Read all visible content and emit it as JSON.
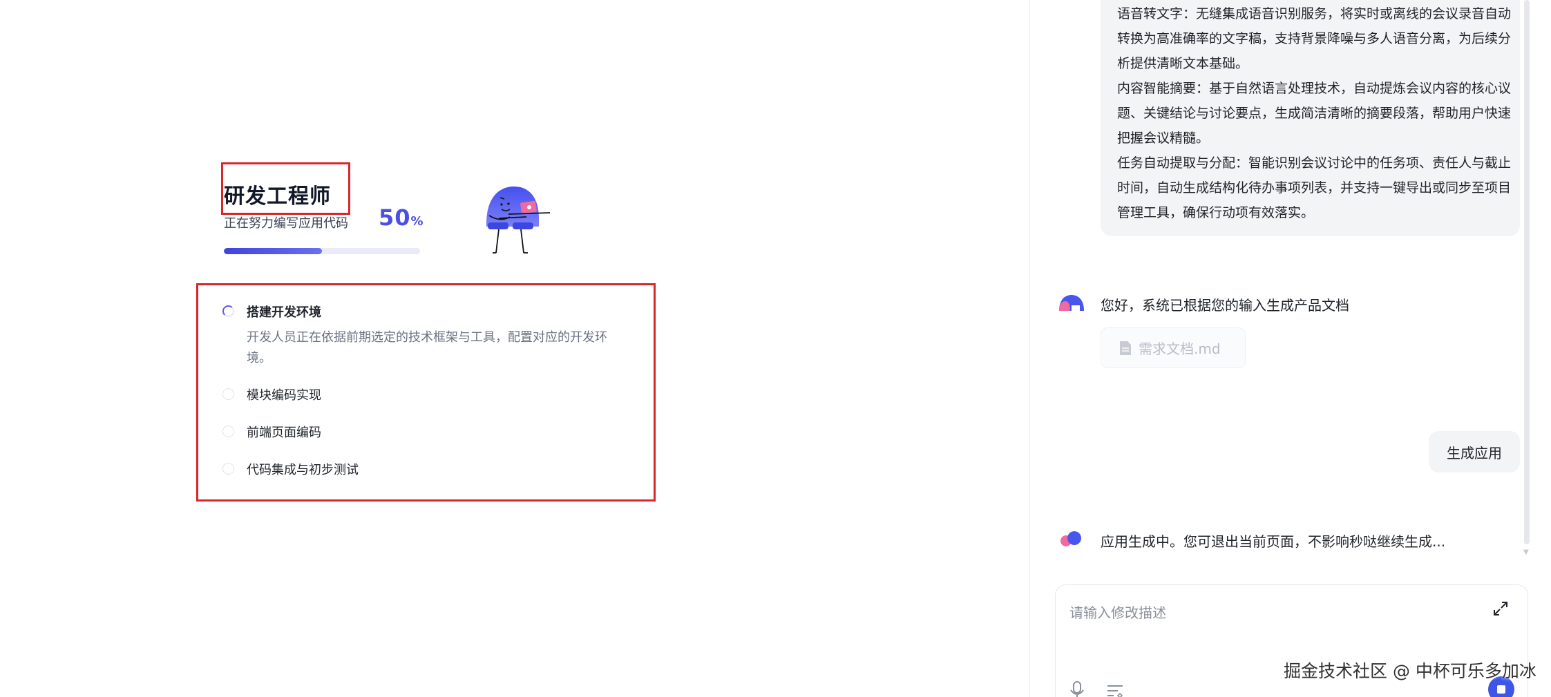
{
  "workflow": {
    "role_title": "研发工程师",
    "role_subtitle": "正在努力编写应用代码",
    "progress_value": "50",
    "progress_unit": "%",
    "progress_fraction": 0.5,
    "steps": [
      {
        "label": "搭建开发环境",
        "status": "in-progress",
        "description": "开发人员正在依据前期选定的技术框架与工具，配置对应的开发环境。"
      },
      {
        "label": "模块编码实现",
        "status": "pending"
      },
      {
        "label": "前端页面编码",
        "status": "pending"
      },
      {
        "label": "代码集成与初步测试",
        "status": "pending"
      }
    ]
  },
  "chat": {
    "requirement_paragraphs": [
      "语音转文字：无缝集成语音识别服务，将实时或离线的会议录音自动转换为高准确率的文字稿，支持背景降噪与多人语音分离，为后续分析提供清晰文本基础。",
      "内容智能摘要：基于自然语言处理技术，自动提炼会议内容的核心议题、关键结论与讨论要点，生成简洁清晰的摘要段落，帮助用户快速把握会议精髓。",
      "任务自动提取与分配：智能识别会议讨论中的任务项、责任人与截止时间，自动生成结构化待办事项列表，并支持一键导出或同步至项目管理工具，确保行动项有效落实。"
    ],
    "bot_message_1": "您好，系统已根据您的输入生成产品文档",
    "attachment_name": "需求文档.md",
    "user_message_2": "生成应用",
    "bot_message_2": "应用生成中。您可退出当前页面，不影响秒哒继续生成..."
  },
  "input": {
    "placeholder": "请输入修改描述",
    "value": ""
  },
  "watermark": "掘金技术社区 @ 中杯可乐多加冰",
  "colors": {
    "accent": "#4b4fe3",
    "highlight_frame": "#d9262c",
    "send_button": "#3d56e8",
    "bubble_bg": "#f3f4f6"
  },
  "icons": {
    "step_active": "spinner-icon",
    "step_pending": "circle-icon",
    "attachment": "document-icon",
    "expand": "expand-icon",
    "mic": "microphone-icon",
    "prompt": "prompt-list-icon",
    "stop": "stop-icon"
  }
}
